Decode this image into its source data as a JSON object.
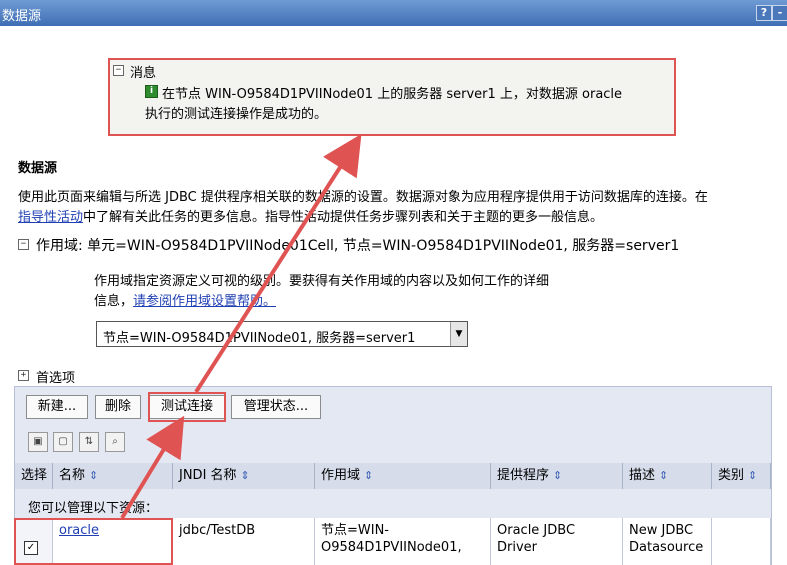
{
  "window": {
    "title": "数据源",
    "help_label": "?",
    "min_label": "-"
  },
  "message": {
    "heading": "消息",
    "line1": "在节点 WIN-O9584D1PVIINode01 上的服务器 server1 上，对数据源 oracle",
    "line2": "执行的测试连接操作是成功的。"
  },
  "section": {
    "title": "数据源",
    "desc1": "使用此页面来编辑与所选 JDBC 提供程序相关联的数据源的设置。数据源对象为应用程序提供用于访问数据库的连接。在",
    "guide_link": "指导性活动",
    "desc2": "中了解有关此任务的更多信息。指导性活动提供任务步骤列表和关于主题的更多一般信息。"
  },
  "scope": {
    "label": "作用域: 单元=WIN-O9584D1PVIINode01Cell, 节点=WIN-O9584D1PVIINode01, 服务器=server1",
    "help1": "作用域指定资源定义可视的级别。要获得有关作用域的内容以及如何工作的详细",
    "help2": "信息，",
    "help_link": "请参阅作用域设置帮助。",
    "selected": "节点=WIN-O9584D1PVIINode01, 服务器=server1"
  },
  "prefs": {
    "label": "首选项"
  },
  "toolbar": {
    "new": "新建...",
    "delete": "删除",
    "test": "测试连接",
    "manage": "管理状态..."
  },
  "table": {
    "headers": {
      "select": "选择",
      "name": "名称",
      "jndi": "JNDI 名称",
      "scope": "作用域",
      "provider": "提供程序",
      "desc": "描述",
      "category": "类别"
    },
    "manage_note": "您可以管理以下资源：",
    "row": {
      "checked": "✓",
      "name": "oracle",
      "jndi": "jdbc/TestDB",
      "scope1": "节点=WIN-",
      "scope2": "O9584D1PVIINode01,",
      "provider1": "Oracle JDBC",
      "provider2": "Driver",
      "desc1": "New JDBC",
      "desc2": "Datasource"
    }
  },
  "colors": {
    "annotation": "#e05353",
    "title_bar": "#3f6eb4",
    "link": "#1f3fb3"
  }
}
